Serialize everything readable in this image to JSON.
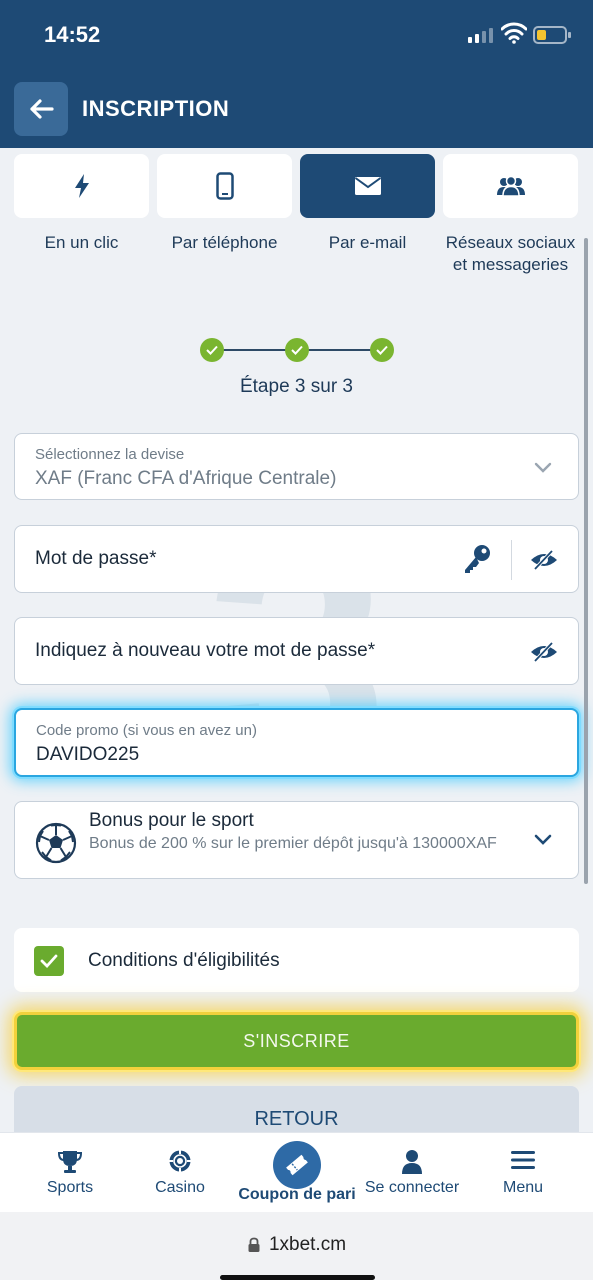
{
  "status_bar": {
    "time": "14:52"
  },
  "header": {
    "title": "INSCRIPTION"
  },
  "registration_tabs": [
    {
      "label": "En un clic",
      "icon": "lightning-icon"
    },
    {
      "label": "Par téléphone",
      "icon": "phone-icon"
    },
    {
      "label": "Par e-mail",
      "icon": "envelope-icon",
      "active": true
    },
    {
      "label": "Réseaux sociaux et messageries",
      "icon": "users-icon"
    }
  ],
  "stepper": {
    "text": "Étape 3 sur 3",
    "total_steps": 3,
    "completed_steps": 3
  },
  "watermark_digit": "3",
  "form": {
    "currency": {
      "label": "Sélectionnez la devise",
      "value": "XAF (Franc CFA d'Afrique Centrale)"
    },
    "password": {
      "label": "Mot de passe*"
    },
    "password_confirm": {
      "label": "Indiquez à nouveau votre mot de passe*"
    },
    "promo": {
      "label": "Code promo (si vous en avez un)",
      "value": "DAVIDO225"
    },
    "bonus": {
      "title": "Bonus pour le sport",
      "description": "Bonus de 200 % sur le premier dépôt jusqu'à 130000XAF"
    },
    "eligibility": {
      "label": "Conditions d'éligibilités",
      "checked": true
    },
    "register_label": "S'INSCRIRE",
    "back_label": "RETOUR"
  },
  "bottom_nav": {
    "sports": "Sports",
    "casino": "Casino",
    "coupon": "Coupon de pari",
    "login": "Se connecter",
    "menu": "Menu"
  },
  "browser": {
    "url": "1xbet.cm"
  },
  "colors": {
    "primary": "#1e4a75",
    "accent_green": "#6aab2e",
    "highlight_blue": "#2aa6e0",
    "highlight_gold": "#f2d13c"
  }
}
